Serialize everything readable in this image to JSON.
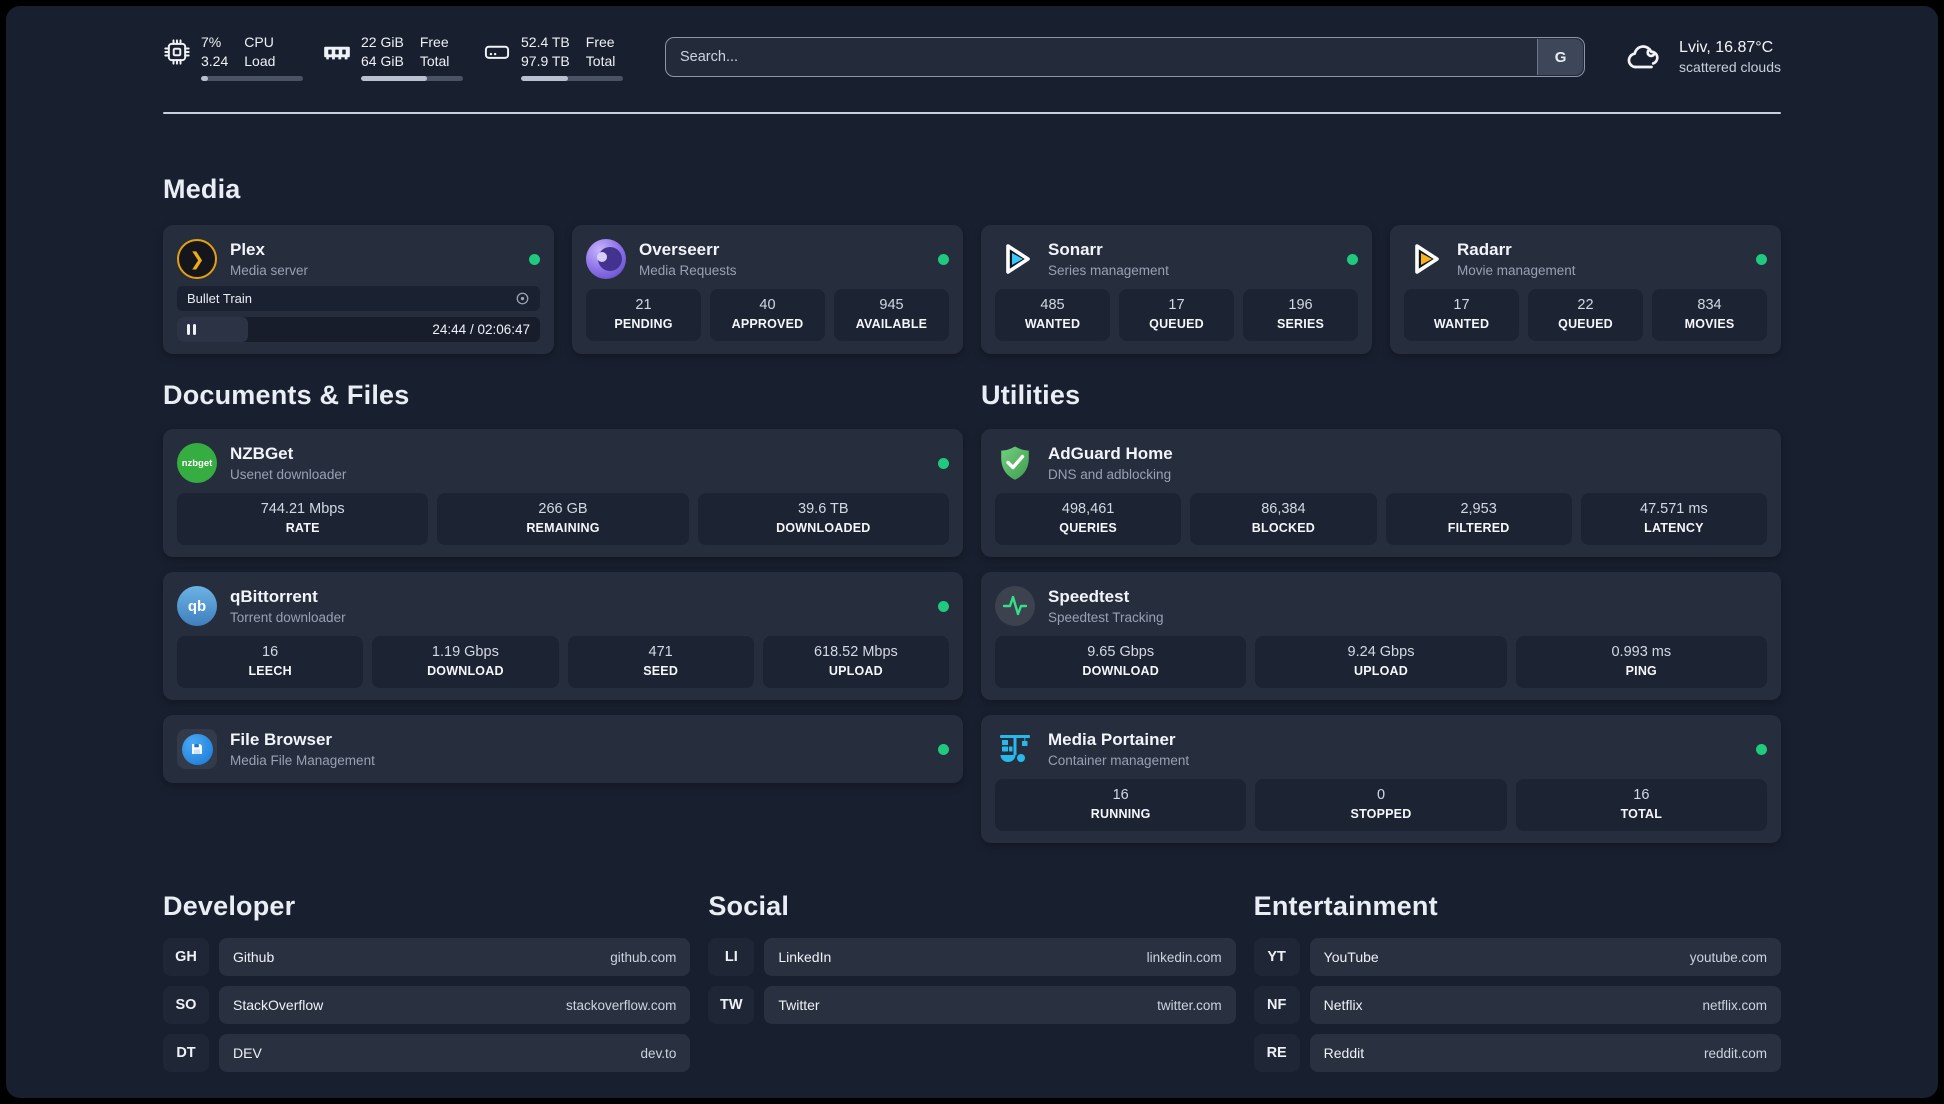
{
  "topbar": {
    "cpu": {
      "values": [
        "7%",
        "3.24"
      ],
      "labels": [
        "CPU",
        "Load"
      ],
      "bar_pct": 7
    },
    "ram": {
      "values": [
        "22 GiB",
        "64 GiB"
      ],
      "labels": [
        "Free",
        "Total"
      ],
      "bar_pct": 65
    },
    "disk": {
      "values": [
        "52.4 TB",
        "97.9 TB"
      ],
      "labels": [
        "Free",
        "Total"
      ],
      "bar_pct": 46
    },
    "search": {
      "placeholder": "Search...",
      "engine_label": "G"
    },
    "weather": {
      "location": "Lviv, 16.87°C",
      "condition": "scattered clouds"
    }
  },
  "media": {
    "heading": "Media",
    "plex": {
      "title": "Plex",
      "subtitle": "Media server",
      "icon_glyph": "❯",
      "now_playing": "Bullet Train",
      "time": "24:44 / 02:06:47",
      "progress_pct": 19.5
    },
    "overseerr": {
      "title": "Overseerr",
      "subtitle": "Media Requests",
      "stats": [
        {
          "value": "21",
          "label": "PENDING"
        },
        {
          "value": "40",
          "label": "APPROVED"
        },
        {
          "value": "945",
          "label": "AVAILABLE"
        }
      ]
    },
    "sonarr": {
      "title": "Sonarr",
      "subtitle": "Series management",
      "stats": [
        {
          "value": "485",
          "label": "WANTED"
        },
        {
          "value": "17",
          "label": "QUEUED"
        },
        {
          "value": "196",
          "label": "SERIES"
        }
      ]
    },
    "radarr": {
      "title": "Radarr",
      "subtitle": "Movie management",
      "stats": [
        {
          "value": "17",
          "label": "WANTED"
        },
        {
          "value": "22",
          "label": "QUEUED"
        },
        {
          "value": "834",
          "label": "MOVIES"
        }
      ]
    }
  },
  "documents": {
    "heading": "Documents & Files",
    "nzbget": {
      "title": "NZBGet",
      "subtitle": "Usenet downloader",
      "icon_text": "nzbget",
      "stats": [
        {
          "value": "744.21 Mbps",
          "label": "RATE"
        },
        {
          "value": "266 GB",
          "label": "REMAINING"
        },
        {
          "value": "39.6 TB",
          "label": "DOWNLOADED"
        }
      ]
    },
    "qbittorrent": {
      "title": "qBittorrent",
      "subtitle": "Torrent downloader",
      "icon_text": "qb",
      "stats": [
        {
          "value": "16",
          "label": "LEECH"
        },
        {
          "value": "1.19 Gbps",
          "label": "DOWNLOAD"
        },
        {
          "value": "471",
          "label": "SEED"
        },
        {
          "value": "618.52 Mbps",
          "label": "UPLOAD"
        }
      ]
    },
    "filebrowser": {
      "title": "File Browser",
      "subtitle": "Media File Management"
    }
  },
  "utilities": {
    "heading": "Utilities",
    "adguard": {
      "title": "AdGuard Home",
      "subtitle": "DNS and adblocking",
      "stats": [
        {
          "value": "498,461",
          "label": "QUERIES"
        },
        {
          "value": "86,384",
          "label": "BLOCKED"
        },
        {
          "value": "2,953",
          "label": "FILTERED"
        },
        {
          "value": "47.571 ms",
          "label": "LATENCY"
        }
      ]
    },
    "speedtest": {
      "title": "Speedtest",
      "subtitle": "Speedtest Tracking",
      "stats": [
        {
          "value": "9.65 Gbps",
          "label": "DOWNLOAD"
        },
        {
          "value": "9.24 Gbps",
          "label": "UPLOAD"
        },
        {
          "value": "0.993 ms",
          "label": "PING"
        }
      ]
    },
    "portainer": {
      "title": "Media Portainer",
      "subtitle": "Container management",
      "stats": [
        {
          "value": "16",
          "label": "RUNNING"
        },
        {
          "value": "0",
          "label": "STOPPED"
        },
        {
          "value": "16",
          "label": "TOTAL"
        }
      ]
    }
  },
  "bookmarks": {
    "developer": {
      "heading": "Developer",
      "items": [
        {
          "abbr": "GH",
          "name": "Github",
          "url": "github.com"
        },
        {
          "abbr": "SO",
          "name": "StackOverflow",
          "url": "stackoverflow.com"
        },
        {
          "abbr": "DT",
          "name": "DEV",
          "url": "dev.to"
        }
      ]
    },
    "social": {
      "heading": "Social",
      "items": [
        {
          "abbr": "LI",
          "name": "LinkedIn",
          "url": "linkedin.com"
        },
        {
          "abbr": "TW",
          "name": "Twitter",
          "url": "twitter.com"
        }
      ]
    },
    "entertainment": {
      "heading": "Entertainment",
      "items": [
        {
          "abbr": "YT",
          "name": "YouTube",
          "url": "youtube.com"
        },
        {
          "abbr": "NF",
          "name": "Netflix",
          "url": "netflix.com"
        },
        {
          "abbr": "RE",
          "name": "Reddit",
          "url": "reddit.com"
        }
      ]
    }
  },
  "colors": {
    "status_online": "#1fc97e",
    "plex": "#e5a00d",
    "sonarr": "#38c6f4",
    "radarr": "#f6b21a",
    "nzbget": "#35ad41",
    "qbittorrent": "#4a8fd0",
    "adguard": "#57bc63",
    "speedtest_pulse": "#35e08a",
    "filebrowser": "#2196f3",
    "portainer": "#29b8ea"
  }
}
